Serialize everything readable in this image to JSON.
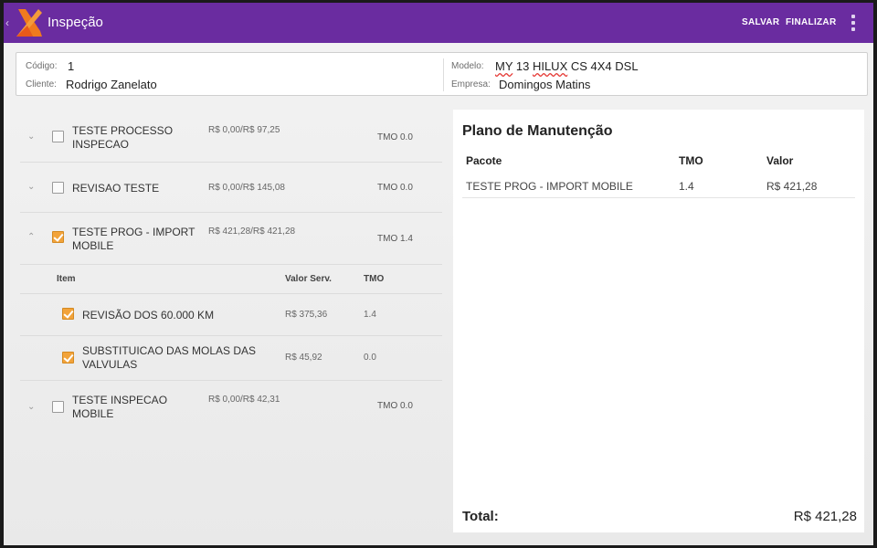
{
  "actionbar": {
    "title": "Inspeção",
    "salvar": "SALVAR",
    "finalizar": "FINALIZAR",
    "brand_color": "#6a2ca0"
  },
  "header": {
    "codigo_label": "Código:",
    "codigo_value": "1",
    "cliente_label": "Cliente:",
    "cliente_value": "Rodrigo Zanelato",
    "modelo_label": "Modelo:",
    "modelo_parts": [
      "MY",
      " 13 ",
      "HILUX",
      " CS 4X4 DSL"
    ],
    "empresa_label": "Empresa:",
    "empresa_value": "Domingos Matins"
  },
  "packages": [
    {
      "name_line1": "TESTE PROCESSO",
      "name_line2": "INSPECAO",
      "price": "R$ 0,00/R$ 97,25",
      "tmo": "TMO 0.0",
      "checked": false,
      "expanded": false
    },
    {
      "name_line1": "REVISAO TESTE",
      "name_line2": "",
      "price": "R$ 0,00/R$ 145,08",
      "tmo": "TMO 0.0",
      "checked": false,
      "expanded": false
    },
    {
      "name_line1": "TESTE PROG - IMPORT",
      "name_line2": "MOBILE",
      "price": "R$ 421,28/R$ 421,28",
      "tmo": "TMO 1.4",
      "checked": true,
      "expanded": true
    },
    {
      "name_line1": "TESTE INSPECAO",
      "name_line2": "MOBILE",
      "price": "R$ 0,00/R$ 42,31",
      "tmo": "TMO 0.0",
      "checked": false,
      "expanded": false
    }
  ],
  "subtable": {
    "headers": [
      "Item",
      "Valor Serv.",
      "TMO"
    ],
    "rows": [
      {
        "line1": "REVISÃO DOS 60.000 KM",
        "line2": "",
        "valor": "R$ 375,36",
        "tmo": "1.4",
        "checked": true
      },
      {
        "line1": "SUBSTITUICAO DAS MOLAS DAS",
        "line2": "VALVULAS",
        "valor": "R$ 45,92",
        "tmo": "0.0",
        "checked": true
      }
    ]
  },
  "plan": {
    "title": "Plano de Manutenção",
    "headers": [
      "Pacote",
      "TMO",
      "Valor"
    ],
    "rows": [
      {
        "pacote": "TESTE PROG - IMPORT MOBILE",
        "tmo": "1.4",
        "valor": "R$ 421,28"
      }
    ],
    "total_label": "Total:",
    "total_value": "R$ 421,28"
  },
  "icons": {
    "logo": "app-logo",
    "overflow": "overflow-menu-icon",
    "checkbox_color": "#f2a33a"
  }
}
